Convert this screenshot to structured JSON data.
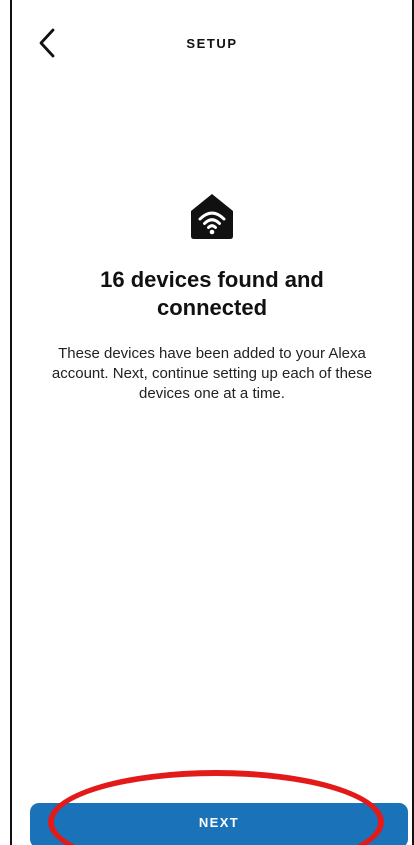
{
  "header": {
    "title": "SETUP",
    "back_icon": "chevron-left-icon"
  },
  "main": {
    "icon": "home-wifi-icon",
    "headline": "16 devices found and connected",
    "body": "These devices have been added to your Alexa account. Next, continue setting up each of these devices one at a time."
  },
  "footer": {
    "next_label": "NEXT"
  },
  "colors": {
    "primary_button": "#1a73b9",
    "highlight_annotation": "#e31a1a",
    "text": "#111111",
    "background": "#ffffff"
  }
}
